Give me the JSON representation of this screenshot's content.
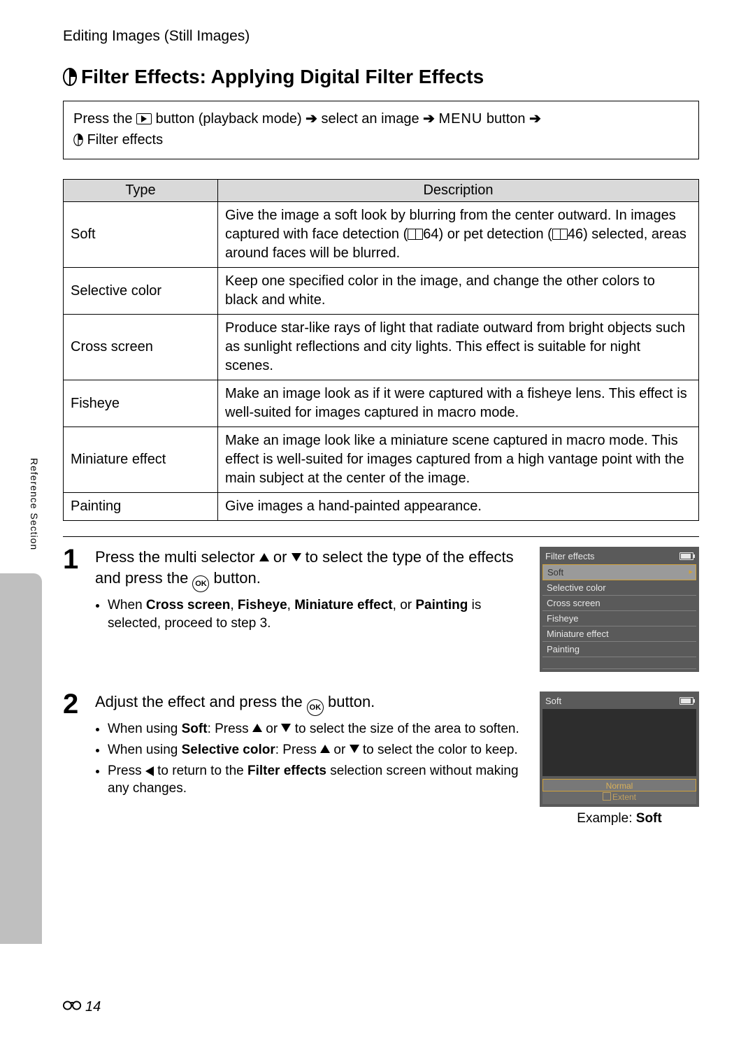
{
  "header": {
    "breadcrumb": "Editing Images (Still Images)"
  },
  "title": "Filter Effects: Applying Digital Filter Effects",
  "nav_box": {
    "pre": "Press the ",
    "after_play": " button (playback mode) ",
    "sel": " select an image ",
    "menu_word": "MENU",
    "button_word": " button ",
    "line2": " Filter effects"
  },
  "table": {
    "headers": {
      "type": "Type",
      "description": "Description"
    },
    "rows": [
      {
        "type": "Soft",
        "desc_pre": "Give the image a soft look by blurring from the center outward. In images captured with face detection (",
        "desc_ref1": "64",
        "desc_mid": ") or pet detection (",
        "desc_ref2": "46",
        "desc_post": ") selected, areas around faces will be blurred."
      },
      {
        "type": "Selective color",
        "desc": "Keep one specified color in the image, and change the other colors to black and white."
      },
      {
        "type": "Cross screen",
        "desc": "Produce star-like rays of light that radiate outward from bright objects such as sunlight reflections and city lights. This effect is suitable for night scenes."
      },
      {
        "type": "Fisheye",
        "desc": "Make an image look as if it were captured with a fisheye lens. This effect is well-suited for images captured in macro mode."
      },
      {
        "type": "Miniature effect",
        "desc": "Make an image look like a miniature scene captured in macro mode. This effect is well-suited for images captured from a high vantage point with the main subject at the center of the image."
      },
      {
        "type": "Painting",
        "desc": "Give images a hand-painted appearance."
      }
    ]
  },
  "steps": {
    "s1": {
      "num": "1",
      "head_pre": "Press the multi selector ",
      "head_mid": " or ",
      "head_post": " to select the type of the effects and press the ",
      "head_end": " button.",
      "bullet_pre": "When ",
      "b_cs": "Cross screen",
      "b_sep1": ", ",
      "b_fe": "Fisheye",
      "b_sep2": ", ",
      "b_me": "Miniature effect",
      "b_sep3": ", or ",
      "b_pt": "Painting",
      "bullet_post": " is selected, proceed to step 3."
    },
    "s2": {
      "num": "2",
      "head_pre": "Adjust the effect and press the ",
      "head_end": " button.",
      "b1_pre": "When using ",
      "b1_bold": "Soft",
      "b1_post_a": ": Press ",
      "b1_mid": " or ",
      "b1_post_b": " to select the size of the area to soften.",
      "b2_pre": "When using ",
      "b2_bold": "Selective color",
      "b2_post_a": ": Press ",
      "b2_mid": " or ",
      "b2_post_b": " to select the color to keep.",
      "b3_pre": "Press ",
      "b3_mid": " to return to the ",
      "b3_bold": "Filter effects",
      "b3_post": " selection screen without making any changes."
    }
  },
  "lcd1": {
    "title": "Filter effects",
    "items": [
      "Soft",
      "Selective color",
      "Cross screen",
      "Fisheye",
      "Miniature effect",
      "Painting"
    ]
  },
  "lcd2": {
    "title": "Soft",
    "slider_label": "Normal",
    "extent": "Extent",
    "caption_pre": "Example: ",
    "caption_bold": "Soft"
  },
  "side_tab": "Reference Section",
  "footer": {
    "page": "14"
  }
}
